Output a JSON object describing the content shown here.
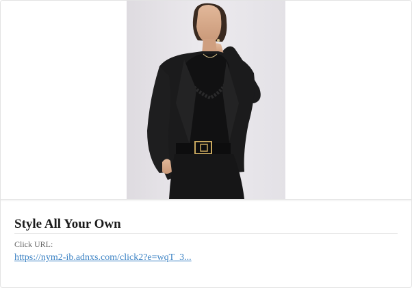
{
  "ad": {
    "title": "Style All Your Own",
    "click_url_label": "Click URL:",
    "click_url": "https://nym2-ib.adnxs.com/click2?e=wqT_3..."
  },
  "colors": {
    "link": "#3b82c4",
    "title": "#1a1a1a",
    "label": "#666666",
    "photo_background": "#e6e4e8",
    "blazer": "#1b1b1c"
  }
}
